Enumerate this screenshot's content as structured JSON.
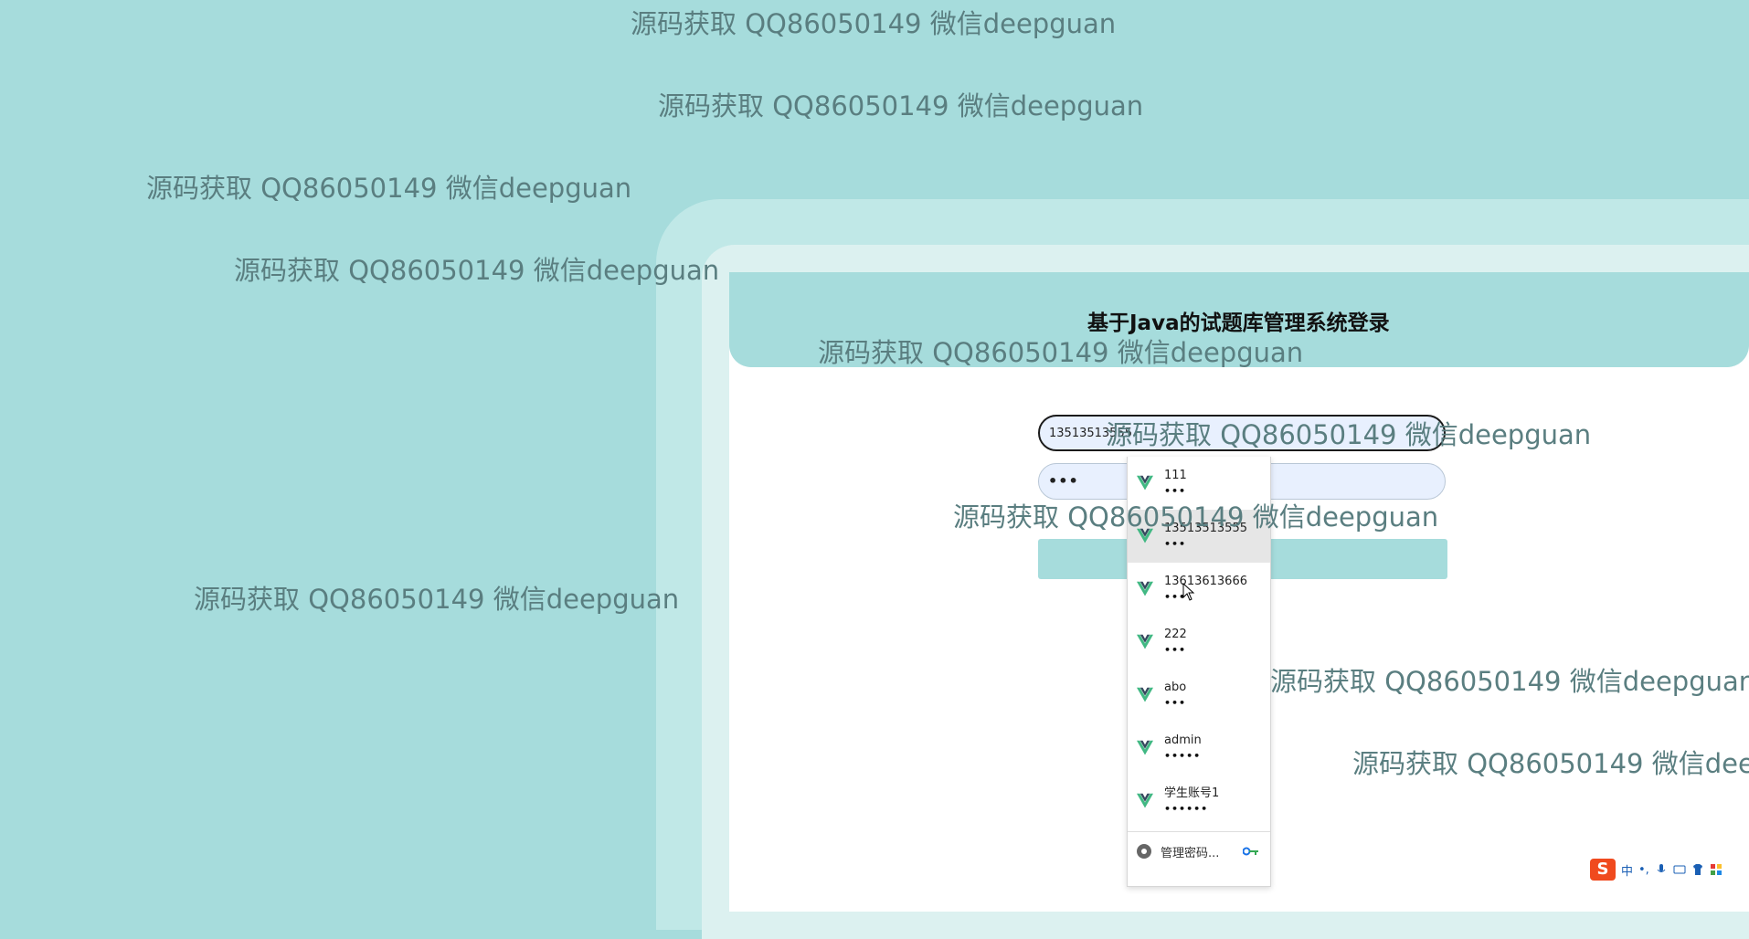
{
  "page": {
    "title": "基于Java的试题库管理系统登录",
    "watermark": "源码获取 QQ86050149 微信deepguan"
  },
  "login": {
    "username_value": "13513513555",
    "password_mask": "•••"
  },
  "autofill": {
    "items": [
      {
        "user": "111",
        "mask": "•••"
      },
      {
        "user": "13513513555",
        "mask": "•••"
      },
      {
        "user": "13613613666",
        "mask": "•••"
      },
      {
        "user": "222",
        "mask": "•••"
      },
      {
        "user": "abo",
        "mask": "•••"
      },
      {
        "user": "admin",
        "mask": "•••••"
      },
      {
        "user": "学生账号1",
        "mask": "••••••"
      }
    ],
    "manage_label": "管理密码..."
  },
  "tray": {
    "ime_logo": "S",
    "ime_lang": "中",
    "ime_punct": "•,"
  },
  "colors": {
    "background": "#a6dcdc",
    "header": "#a6dcdc",
    "watermark": "#5a7e80",
    "vue_green": "#41b883",
    "vue_dark": "#35495e"
  }
}
